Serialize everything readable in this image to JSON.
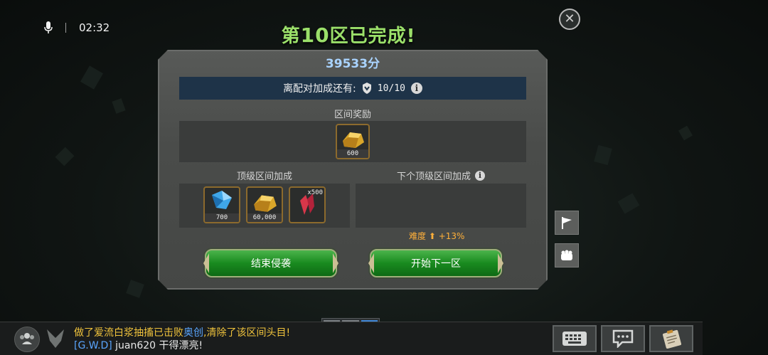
{
  "status": {
    "time": "02:32"
  },
  "title": {
    "prefix": "第",
    "number": "10",
    "suffix": "区已完成!"
  },
  "score": "39533分",
  "bonus": {
    "label": "离配对加成还有:",
    "count": "10/10"
  },
  "zone_reward": {
    "label": "区间奖励",
    "items": [
      {
        "icon": "gold-ingot-icon",
        "qty": "600"
      }
    ]
  },
  "top_bonus": {
    "label": "顶级区间加成",
    "items": [
      {
        "icon": "blue-crystal-icon",
        "qty": "700"
      },
      {
        "icon": "gold-ingot-icon",
        "qty": "60,000"
      },
      {
        "icon": "red-shard-icon",
        "qty": "x500"
      }
    ]
  },
  "next_top_bonus": {
    "label": "下个顶级区间加成"
  },
  "difficulty": {
    "label": "难度",
    "value": "+13%"
  },
  "buttons": {
    "end": "结束侵袭",
    "next": "开始下一区"
  },
  "chat": {
    "line1": {
      "before": "做了爱流白浆抽搐已击败",
      "hero": "奥创",
      "after": ",清除了该区间头目!"
    },
    "line2": {
      "tag": "[G.W.D]",
      "text": " juan620 干得漂亮!"
    }
  },
  "colors": {
    "title_green": "#9be06a",
    "score_blue": "#a9d3ff",
    "difficulty_orange": "#ffb03a",
    "button_green": "#198a1f"
  }
}
